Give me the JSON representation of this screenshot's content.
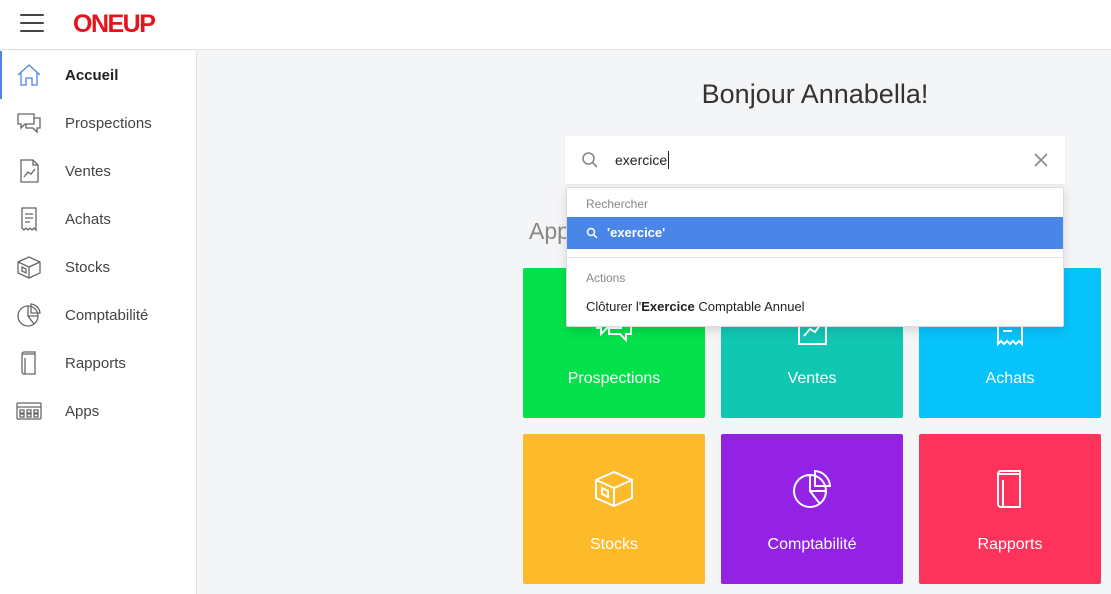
{
  "brand": {
    "logo_text": "ONEUP"
  },
  "sidebar": {
    "items": [
      {
        "label": "Accueil",
        "icon": "home-icon"
      },
      {
        "label": "Prospections",
        "icon": "chat-icon"
      },
      {
        "label": "Ventes",
        "icon": "chart-doc-icon"
      },
      {
        "label": "Achats",
        "icon": "receipt-icon"
      },
      {
        "label": "Stocks",
        "icon": "box-icon"
      },
      {
        "label": "Comptabilité",
        "icon": "pie-chart-icon"
      },
      {
        "label": "Rapports",
        "icon": "book-icon"
      },
      {
        "label": "Apps",
        "icon": "apps-grid-icon"
      }
    ]
  },
  "main": {
    "greeting": "Bonjour Annabella!",
    "apps_title": "Apps"
  },
  "search": {
    "value": "exercice"
  },
  "dropdown": {
    "search_header": "Rechercher",
    "search_suggestion": "'exercice'",
    "actions_header": "Actions",
    "action_prefix": "Clôturer l'",
    "action_bold": "Exercice",
    "action_suffix": " Comptable Annuel"
  },
  "tiles": [
    {
      "label": "Prospections",
      "color": "#04e14a"
    },
    {
      "label": "Ventes",
      "color": "#11c7b2"
    },
    {
      "label": "Achats",
      "color": "#06c3fb"
    },
    {
      "label": "Stocks",
      "color": "#fdbb2c"
    },
    {
      "label": "Comptabilité",
      "color": "#9322e5"
    },
    {
      "label": "Rapports",
      "color": "#fe335b"
    }
  ],
  "colors": {
    "accent": "#4a86e8",
    "brand_red": "#e8141d"
  }
}
